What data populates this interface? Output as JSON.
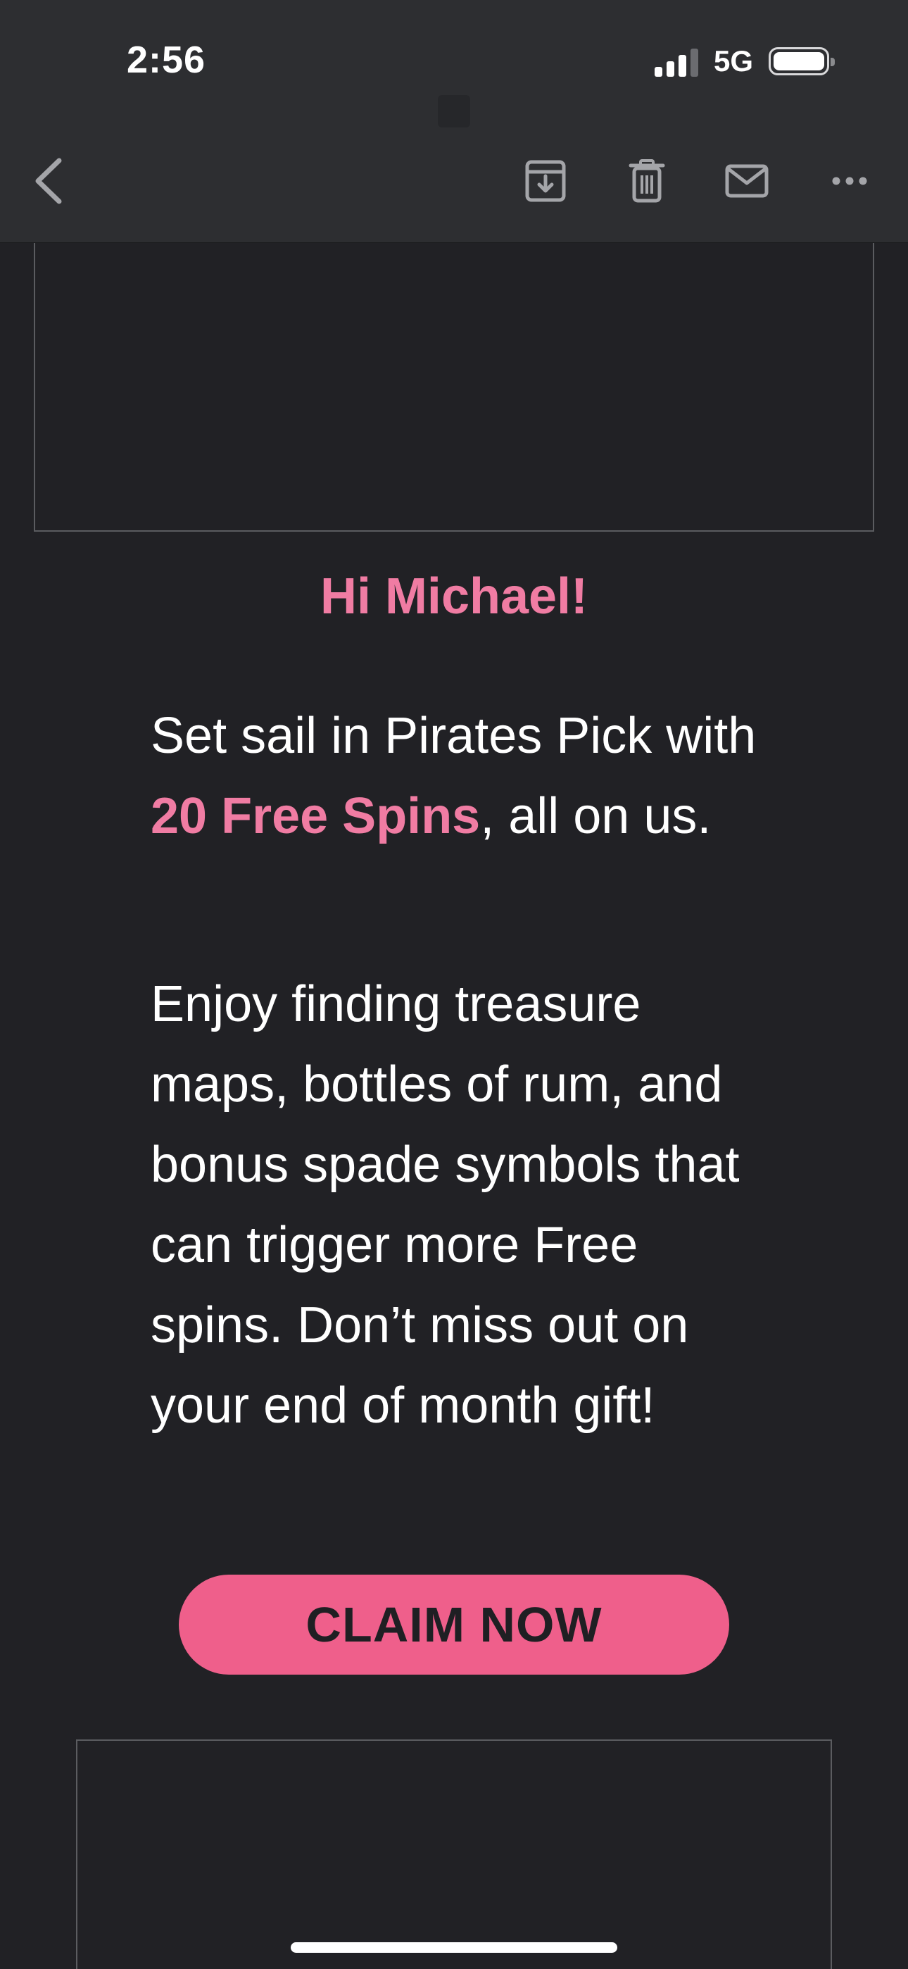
{
  "status_bar": {
    "time": "2:56",
    "network": "5G"
  },
  "toolbar": {
    "back_icon": "chevron-left-icon",
    "archive_icon": "archive-icon",
    "trash_icon": "trash-icon",
    "mail_icon": "mail-icon",
    "more_icon": "more-icon"
  },
  "email": {
    "greeting": "Hi Michael!",
    "para1_before": "Set sail in Pirates Pick with ",
    "para1_highlight": "20 Free Spins",
    "para1_after": ", all on us.",
    "para2": "Enjoy finding treasure maps, bottles of rum, and bonus spade symbols that can trigger more Free spins. Don’t miss out on your end of month gift!",
    "cta_label": "CLAIM NOW"
  },
  "colors": {
    "background": "#212125",
    "toolbar": "#2d2e31",
    "accent_pink": "#f07ca3",
    "button_pink": "#ef5f8b",
    "text": "#ffffff"
  }
}
